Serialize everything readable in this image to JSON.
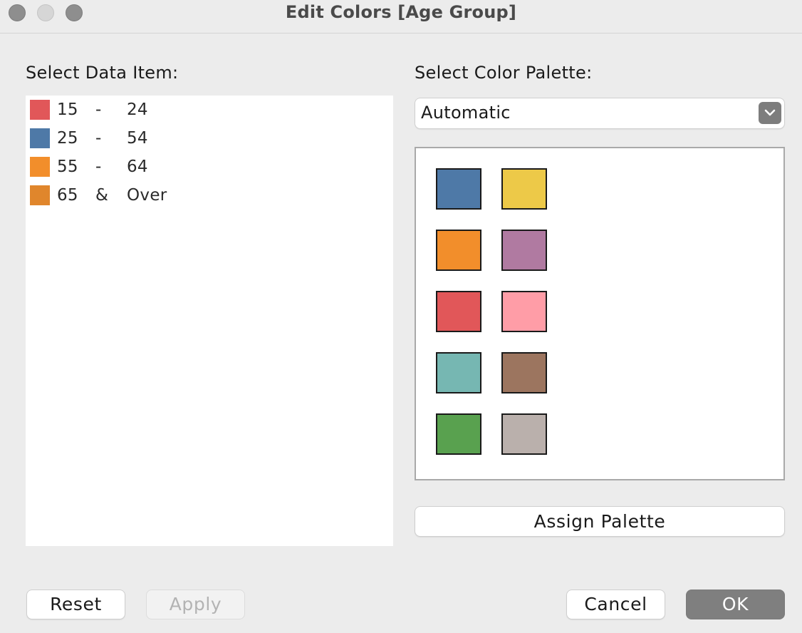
{
  "window": {
    "title": "Edit Colors [Age Group]"
  },
  "left": {
    "label": "Select Data Item:",
    "items": [
      {
        "from": "15",
        "sep": "-",
        "to": "24",
        "color": "#e15759"
      },
      {
        "from": "25",
        "sep": "-",
        "to": "54",
        "color": "#4e79a7"
      },
      {
        "from": "55",
        "sep": "-",
        "to": "64",
        "color": "#f28e2b"
      },
      {
        "from": "65",
        "sep": "&",
        "to": "Over",
        "color": "#e0862c"
      }
    ]
  },
  "right": {
    "label": "Select Color Palette:",
    "palette_value": "Automatic",
    "palette_colors": [
      "#4e79a7",
      "#edc948",
      "#f28e2b",
      "#b07aa1",
      "#e15759",
      "#ff9da7",
      "#76b7b2",
      "#9c755f",
      "#59a14f",
      "#bab0ac"
    ],
    "assign_label": "Assign Palette"
  },
  "footer": {
    "reset_label": "Reset",
    "apply_label": "Apply",
    "cancel_label": "Cancel",
    "ok_label": "OK"
  }
}
